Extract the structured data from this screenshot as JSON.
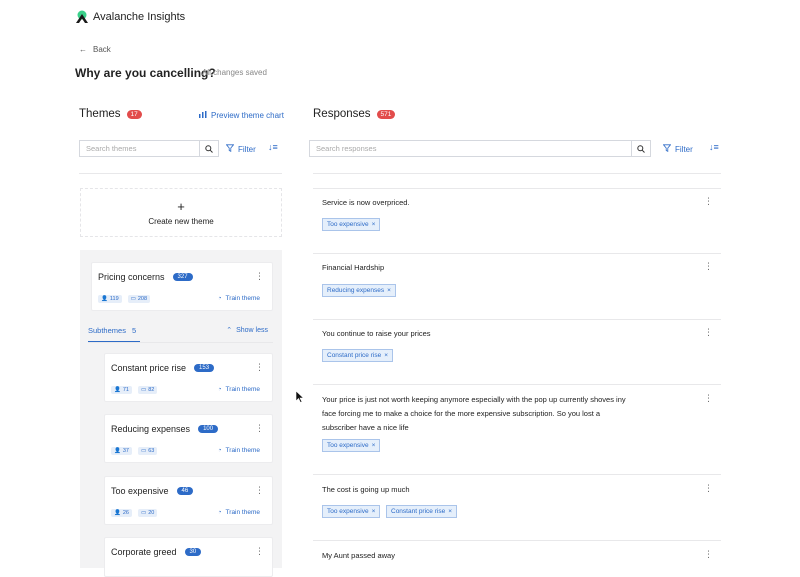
{
  "app": {
    "title": "Avalanche Insights"
  },
  "nav": {
    "back_label": "Back"
  },
  "page": {
    "title": "Why are you cancelling?",
    "save_status": "All changes saved"
  },
  "themes": {
    "heading": "Themes",
    "count": "17",
    "preview_label": "Preview theme chart",
    "search_placeholder": "Search themes",
    "filter_label": "Filter",
    "create_label": "Create new theme",
    "parent": {
      "name": "Pricing concerns",
      "count": "327",
      "users": "119",
      "comments": "208",
      "train_label": "Train theme"
    },
    "subthemes_label": "Subthemes",
    "subthemes_count": "5",
    "show_less_label": "Show less",
    "subthemes": [
      {
        "name": "Constant price rise",
        "count": "153",
        "users": "71",
        "comments": "82",
        "train_label": "Train theme"
      },
      {
        "name": "Reducing expenses",
        "count": "100",
        "users": "37",
        "comments": "63",
        "train_label": "Train theme"
      },
      {
        "name": "Too expensive",
        "count": "46",
        "users": "26",
        "comments": "20",
        "train_label": "Train theme"
      },
      {
        "name": "Corporate greed",
        "count": "30"
      }
    ]
  },
  "responses": {
    "heading": "Responses",
    "count": "571",
    "search_placeholder": "Search responses",
    "filter_label": "Filter",
    "items": [
      {
        "text": "Service is now overpriced.",
        "tags": [
          "Too expensive"
        ]
      },
      {
        "text": "Financial Hardship",
        "tags": [
          "Reducing expenses"
        ]
      },
      {
        "text": "You continue to raise your prices",
        "tags": [
          "Constant price rise"
        ]
      },
      {
        "text": "Your price is just not worth keeping anymore especially with the pop up currently shoves iny face forcing me to make a choice for the more expensive subscription. So you lost a subscriber have a nice life",
        "tags": [
          "Too expensive"
        ]
      },
      {
        "text": "The cost is going up much",
        "tags": [
          "Too expensive",
          "Constant price rise"
        ]
      },
      {
        "text": "My Aunt passed away",
        "tags": []
      }
    ]
  },
  "colors": {
    "accent": "#2d6bc7",
    "badge_red": "#e24c4b",
    "logo_green": "#3ad08a"
  }
}
